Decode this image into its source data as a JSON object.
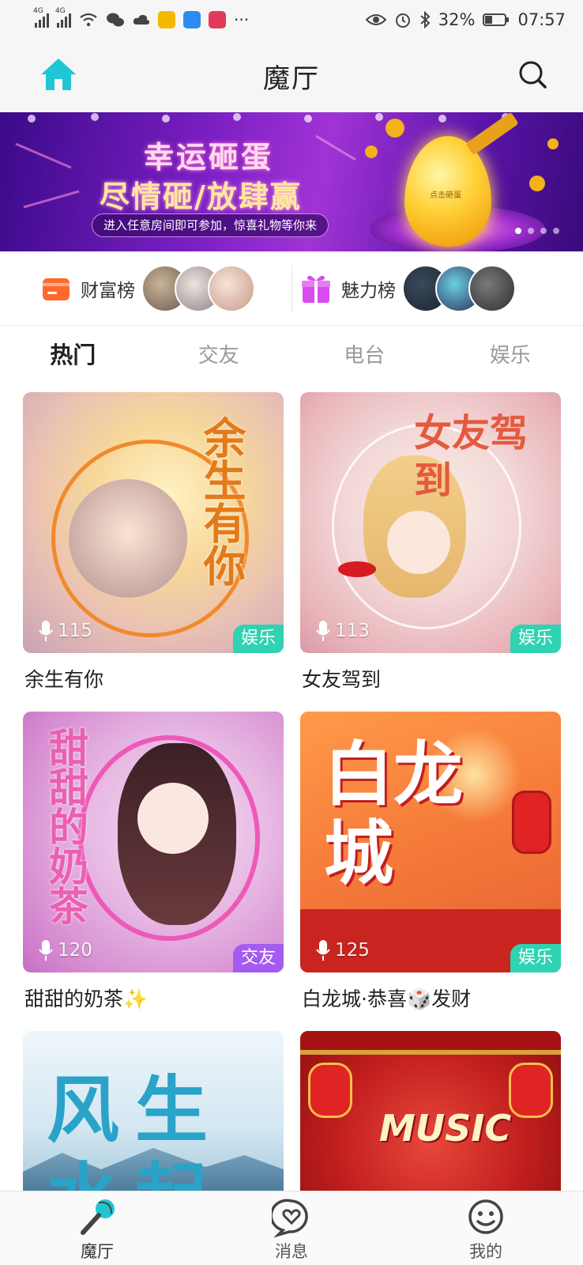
{
  "status_bar": {
    "network_labels": [
      "4G",
      "4G"
    ],
    "battery": "32%",
    "time": "07:57",
    "more": "···"
  },
  "header": {
    "title": "魔厅"
  },
  "banner": {
    "line1": "幸运砸蛋",
    "line2": "尽情砸/放肆赢",
    "subtitle": "进入任意房间即可参加，惊喜礼物等你来",
    "egg_label": "点击砸蛋"
  },
  "rankings": [
    {
      "label": "财富榜",
      "icon": "wallet-icon",
      "color": "#ff6a2c"
    },
    {
      "label": "魅力榜",
      "icon": "gift-icon",
      "color": "#d94cf0"
    }
  ],
  "tabs": [
    {
      "label": "热门",
      "active": true
    },
    {
      "label": "交友",
      "active": false
    },
    {
      "label": "电台",
      "active": false
    },
    {
      "label": "娱乐",
      "active": false
    }
  ],
  "rooms": [
    {
      "name": "余生有你",
      "count": "115",
      "tag": "娱乐",
      "tag_color": "#2fd3b1",
      "cover_text": "余生有你"
    },
    {
      "name": "女友驾到",
      "count": "113",
      "tag": "娱乐",
      "tag_color": "#2fd3b1",
      "cover_text": "女友驾到"
    },
    {
      "name": "甜甜的奶茶✨",
      "count": "120",
      "tag": "交友",
      "tag_color": "#a45bf0",
      "cover_text": "甜甜的奶茶"
    },
    {
      "name": "白龙城·恭喜🎲发财",
      "count": "125",
      "tag": "娱乐",
      "tag_color": "#2fd3b1",
      "cover_text": "白龙城"
    },
    {
      "name": "",
      "count": "",
      "tag": "",
      "tag_color": "#2fd3b1",
      "cover_text": "风生水起"
    },
    {
      "name": "",
      "count": "",
      "tag": "",
      "tag_color": "#2fd3b1",
      "cover_text": "MUSIC"
    }
  ],
  "bottom_nav": [
    {
      "label": "魔厅",
      "icon": "microphone-icon",
      "active": true
    },
    {
      "label": "消息",
      "icon": "message-heart-icon",
      "active": false
    },
    {
      "label": "我的",
      "icon": "smiley-icon",
      "active": false
    }
  ],
  "colors": {
    "accent": "#1fc7d4",
    "tag_green": "#2fd3b1",
    "tag_purple": "#a45bf0"
  }
}
